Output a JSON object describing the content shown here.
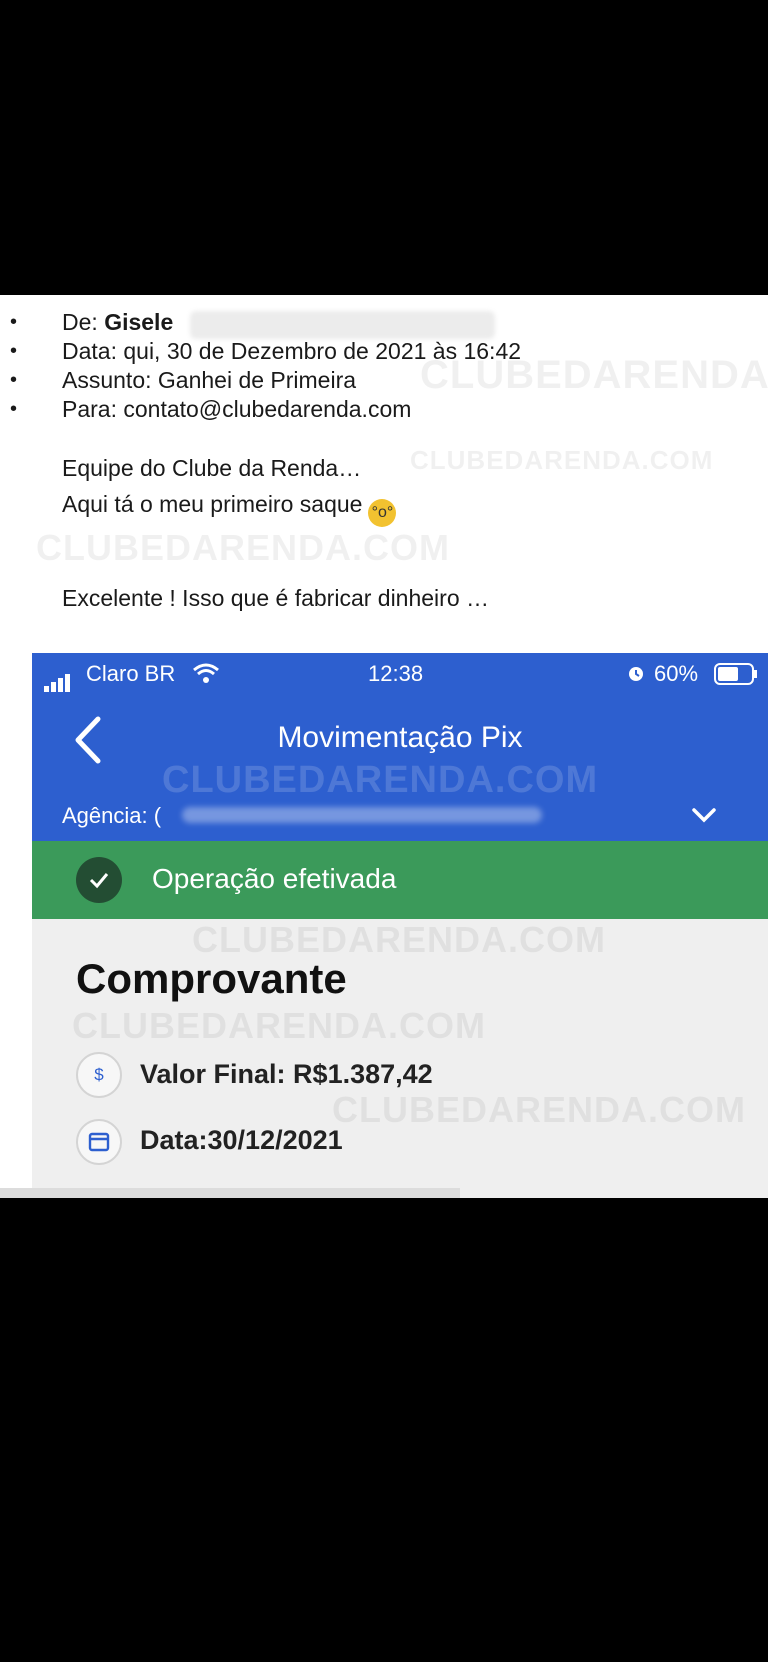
{
  "email": {
    "from_label": "De: ",
    "from_name": "Gisele",
    "date_line": "Data: qui, 30 de Dezembro de 2021 às 16:42",
    "subject_line": "Assunto: Ganhei de Primeira",
    "to_line": "Para: contato@clubedarenda.com",
    "body_line_1": "Equipe do Clube da Renda…",
    "body_line_2": "Aqui tá o meu primeiro saque",
    "body_line_3": "Excelente ! Isso que é fabricar dinheiro …"
  },
  "watermark": "CLUBEDARENDA.COM",
  "phone": {
    "carrier": "Claro BR",
    "time": "12:38",
    "battery": "60%",
    "title": "Movimentação Pix",
    "agency_label": "Agência: (",
    "status": "Operação efetivada",
    "receipt_title": "Comprovante",
    "value_label": "Valor Final: R$",
    "value_amount": "1.387,42",
    "date_label": "Data:",
    "date_value": "30/12/2021"
  },
  "colors": {
    "app_blue": "#2d5fcf",
    "success_green": "#3b9a5a"
  },
  "icons": [
    "wifi-icon",
    "alarm-icon",
    "battery-icon",
    "back-chevron-icon",
    "chevron-down-icon",
    "check-icon",
    "dollar-icon",
    "calendar-icon"
  ]
}
